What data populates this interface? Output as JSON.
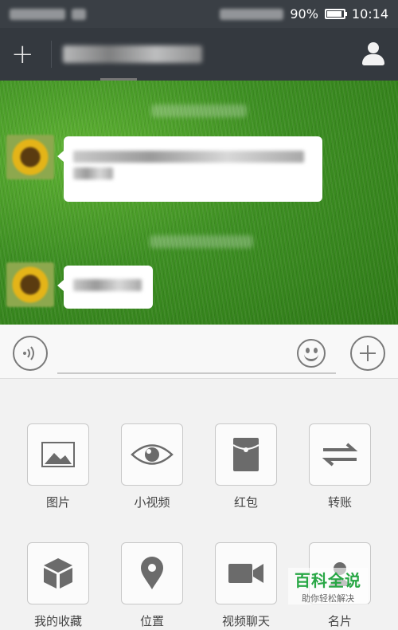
{
  "status_bar": {
    "battery": "90%",
    "time": "10:14",
    "battery_level": 0.9
  },
  "title_bar": {
    "add_icon": "plus-icon",
    "profile_icon": "person-icon"
  },
  "input_bar": {
    "voice_icon": "voice-icon",
    "emoji_icon": "emoji-icon",
    "more_icon": "plus-circle-icon"
  },
  "panel": {
    "items": [
      {
        "label": "图片",
        "icon": "image-icon"
      },
      {
        "label": "小视频",
        "icon": "eye-icon"
      },
      {
        "label": "红包",
        "icon": "red-packet-icon"
      },
      {
        "label": "转账",
        "icon": "transfer-icon"
      },
      {
        "label": "我的收藏",
        "icon": "favorites-box-icon"
      },
      {
        "label": "位置",
        "icon": "location-pin-icon"
      },
      {
        "label": "视频聊天",
        "icon": "video-camera-icon"
      },
      {
        "label": "名片",
        "icon": "contact-card-icon"
      }
    ]
  },
  "watermark": {
    "main": "百科全说",
    "sub": "助你轻松解决"
  }
}
